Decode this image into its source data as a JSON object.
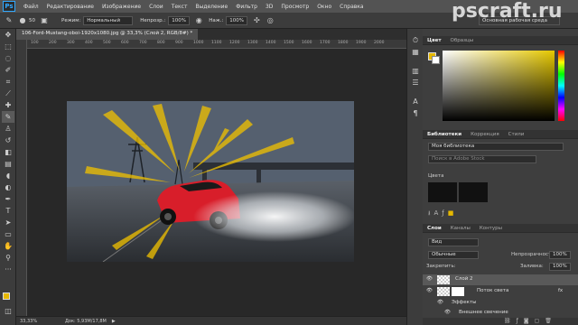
{
  "app": {
    "logo": "Ps",
    "workspace": "Основная рабочая среда"
  },
  "menu": [
    "Файл",
    "Редактирование",
    "Изображение",
    "Слои",
    "Текст",
    "Выделение",
    "Фильтр",
    "3D",
    "Просмотр",
    "Окно",
    "Справка"
  ],
  "options": {
    "mode_label": "Режим:",
    "mode_value": "Нормальный",
    "opacity_label": "Непрозр.:",
    "opacity_value": "100%",
    "pressure_label": "Наж.:",
    "pressure_value": "100%",
    "brush_size": "50"
  },
  "document": {
    "tab_title": "106-Ford-Mustang-oboi-1920x1080.jpg @ 33,3% (Слой 2, RGB/8#) *",
    "ruler_ticks": [
      "100",
      "200",
      "300",
      "400",
      "500",
      "600",
      "700",
      "800",
      "900",
      "1000",
      "1100",
      "1200",
      "1300",
      "1400",
      "1500",
      "1600",
      "1700",
      "1800",
      "1900",
      "2000"
    ]
  },
  "status": {
    "zoom": "33,33%",
    "doc_info": "Док: 5,93М/17,8М"
  },
  "watermark": "pscraft.ru",
  "color_panel": {
    "tabs": [
      "Цвет",
      "Образцы"
    ],
    "fg_color": "#e6b800",
    "bg_color": "#ffffff"
  },
  "libraries_panel": {
    "tabs": [
      "Библиотеки",
      "Коррекция",
      "Стили"
    ],
    "library_name": "Моя библиотека",
    "search_placeholder": "Поиск в Adobe Stock",
    "section_title": "Цвета"
  },
  "layers_panel": {
    "tabs": [
      "Слои",
      "Каналы",
      "Контуры"
    ],
    "filter_label": "Вид",
    "blend_mode": "Обычные",
    "opacity_label": "Непрозрачность:",
    "opacity_value": "100%",
    "lock_label": "Закрепить:",
    "fill_label": "Заливка:",
    "fill_value": "100%",
    "layers": [
      {
        "name": "Слой 2",
        "selected": true
      },
      {
        "name": "Поток света",
        "selected": false
      }
    ],
    "effects_label": "Эффекты",
    "effect_item": "Внешнее свечение",
    "fx": "fx"
  }
}
